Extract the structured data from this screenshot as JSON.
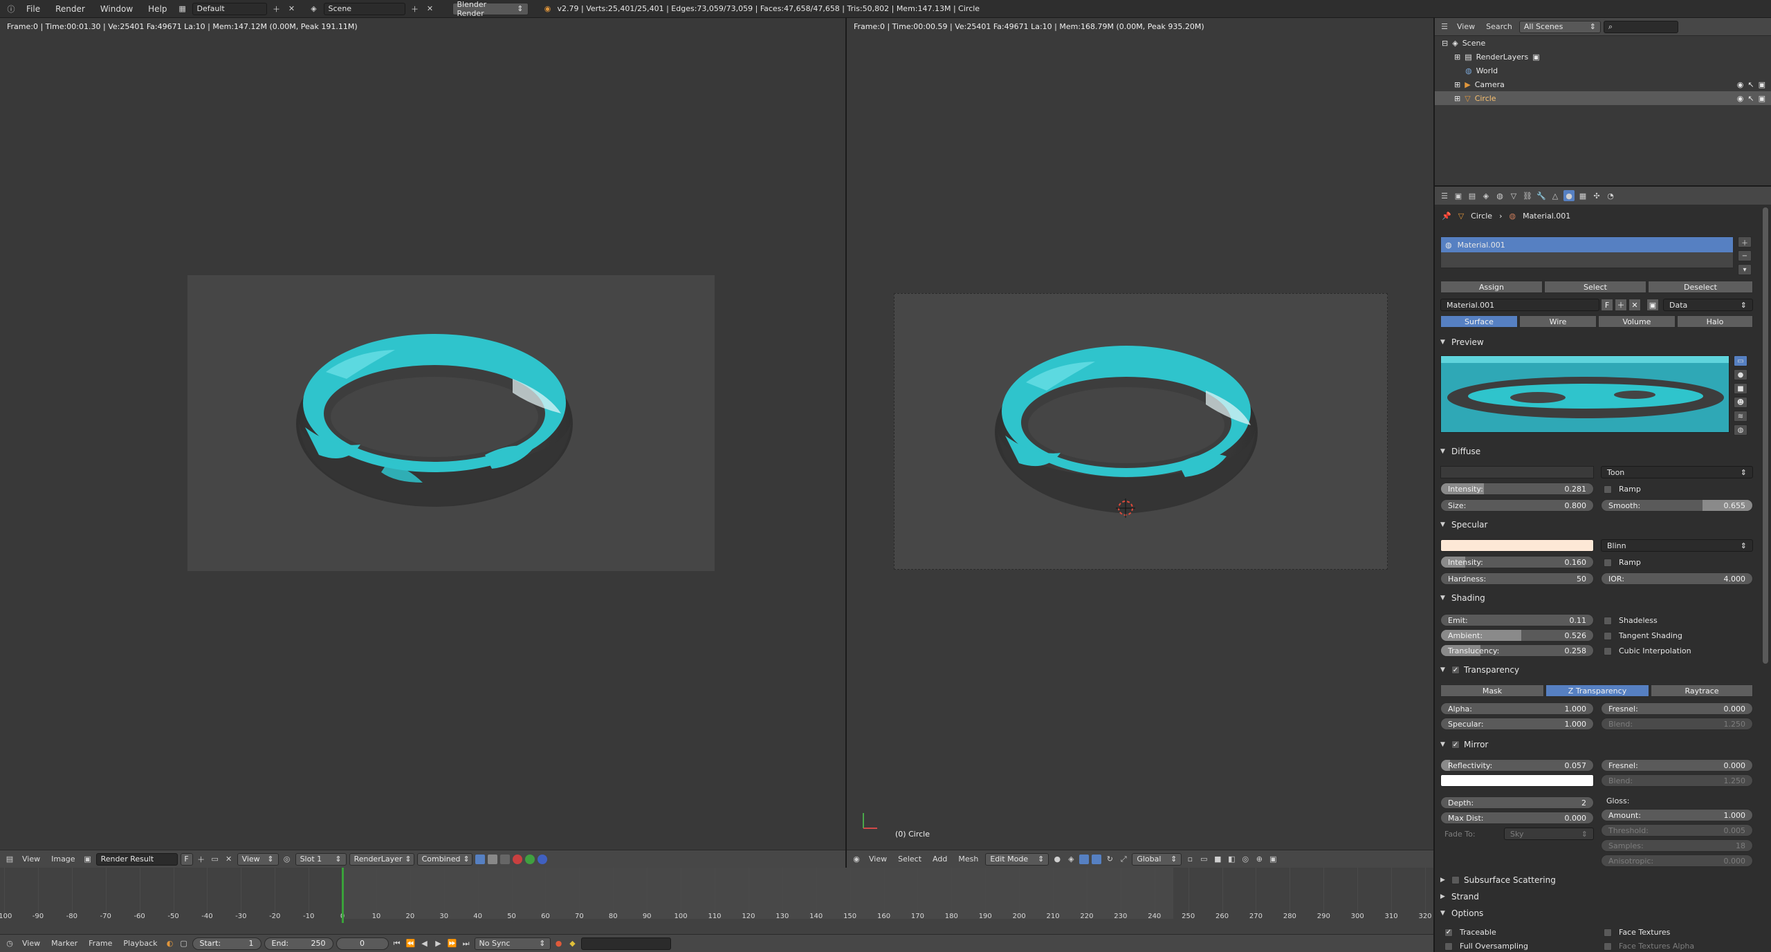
{
  "topbar": {
    "menus": [
      "File",
      "Render",
      "Window",
      "Help"
    ],
    "layout": "Default",
    "scene": "Scene",
    "engine": "Blender Render",
    "stats": "v2.79 | Verts:25,401/25,401 | Edges:73,059/73,059 | Faces:47,658/47,658 | Tris:50,802 | Mem:147.13M | Circle"
  },
  "left_view": {
    "info": "Frame:0 | Time:00:01.30 | Ve:25401 Fa:49671 La:10 | Mem:147.12M (0.00M, Peak 191.11M)",
    "header": {
      "menus": [
        "View",
        "Image"
      ],
      "image": "Render Result",
      "image_flag": "F",
      "view": "View",
      "slot": "Slot 1",
      "layer": "RenderLayer",
      "pass": "Combined"
    }
  },
  "right_view": {
    "info": "Frame:0 | Time:00:00.59 | Ve:25401 Fa:49671 La:10 | Mem:168.79M (0.00M, Peak 935.20M)",
    "object_label": "(0) Circle",
    "header": {
      "menus": [
        "View",
        "Select",
        "Add",
        "Mesh"
      ],
      "mode": "Edit Mode",
      "orientation": "Global"
    }
  },
  "timeline": {
    "ticks": [
      "-100",
      "-90",
      "-80",
      "-70",
      "-60",
      "-50",
      "-40",
      "-30",
      "-20",
      "-10",
      "0",
      "10",
      "20",
      "30",
      "40",
      "50",
      "60",
      "70",
      "80",
      "90",
      "100",
      "110",
      "120",
      "130",
      "140",
      "150",
      "160",
      "170",
      "180",
      "190",
      "200",
      "210",
      "220",
      "230",
      "240",
      "250",
      "260",
      "270",
      "280",
      "290",
      "300",
      "310",
      "320"
    ],
    "current_frame": 0,
    "menus": [
      "View",
      "Marker",
      "Frame",
      "Playback"
    ],
    "start_label": "Start:",
    "start": "1",
    "end_label": "End:",
    "end": "250",
    "frame": "0",
    "sync": "No Sync"
  },
  "outliner": {
    "menus": [
      "View",
      "Search"
    ],
    "scenes": "All Scenes",
    "items": [
      {
        "label": "Scene"
      },
      {
        "label": "RenderLayers"
      },
      {
        "label": "World"
      },
      {
        "label": "Camera"
      },
      {
        "label": "Circle"
      }
    ]
  },
  "properties": {
    "breadcrumb": {
      "object": "Circle",
      "material": "Material.001"
    },
    "slot_name": "Material.001",
    "assign": "Assign",
    "select": "Select",
    "deselect": "Deselect",
    "material_name": "Material.001",
    "material_flag": "F",
    "link": "Data",
    "tabs": [
      "Surface",
      "Wire",
      "Volume",
      "Halo"
    ],
    "preview_title": "Preview",
    "diffuse": {
      "title": "Diffuse",
      "shader": "Toon",
      "intensity_label": "Intensity:",
      "intensity": "0.281",
      "intensity_v": 0.281,
      "ramp": "Ramp",
      "size_label": "Size:",
      "size": "0.800",
      "smooth_label": "Smooth:",
      "smooth": "0.655",
      "smooth_v": 0.33
    },
    "specular": {
      "title": "Specular",
      "shader": "Blinn",
      "color": "#fde8d6",
      "intensity_label": "Intensity:",
      "intensity": "0.160",
      "intensity_v": 0.16,
      "ramp": "Ramp",
      "hardness_label": "Hardness:",
      "hardness": "50",
      "ior_label": "IOR:",
      "ior": "4.000"
    },
    "shading": {
      "title": "Shading",
      "emit_label": "Emit:",
      "emit": "0.11",
      "ambient_label": "Ambient:",
      "ambient": "0.526",
      "ambient_v": 0.526,
      "translucency_label": "Translucency:",
      "translucency": "0.258",
      "translucency_v": 0.258,
      "shadeless": "Shadeless",
      "tangent": "Tangent Shading",
      "cubic": "Cubic Interpolation"
    },
    "transparency": {
      "title": "Transparency",
      "modes": [
        "Mask",
        "Z Transparency",
        "Raytrace"
      ],
      "alpha_label": "Alpha:",
      "alpha": "1.000",
      "specular_label": "Specular:",
      "specular": "1.000",
      "fresnel_label": "Fresnel:",
      "fresnel": "0.000",
      "blend_label": "Blend:",
      "blend": "1.250"
    },
    "mirror": {
      "title": "Mirror",
      "reflectivity_label": "Reflectivity:",
      "reflectivity": "0.057",
      "reflectivity_v": 0.057,
      "fresnel_label": "Fresnel:",
      "fresnel": "0.000",
      "blend_label": "Blend:",
      "blend": "1.250",
      "depth_label": "Depth:",
      "depth": "2",
      "maxdist_label": "Max Dist:",
      "maxdist": "0.000",
      "fadeto_label": "Fade To:",
      "fadeto": "Sky",
      "gloss_label": "Gloss:",
      "amount_label": "Amount:",
      "amount": "1.000",
      "threshold_label": "Threshold:",
      "threshold": "0.005",
      "samples_label": "Samples:",
      "samples": "18",
      "anisotropic_label": "Anisotropic:",
      "anisotropic": "0.000"
    },
    "sss_title": "Subsurface Scattering",
    "strand_title": "Strand",
    "options": {
      "title": "Options",
      "traceable": "Traceable",
      "face_textures": "Face Textures",
      "full_oversampling": "Full Oversampling",
      "face_textures_alpha": "Face Textures Alpha"
    }
  },
  "colors": {
    "accent": "#5680c2",
    "ring_teal": "#2fc4cc",
    "ring_gray": "#3a3a3a",
    "playhead": "#3aa23a"
  }
}
